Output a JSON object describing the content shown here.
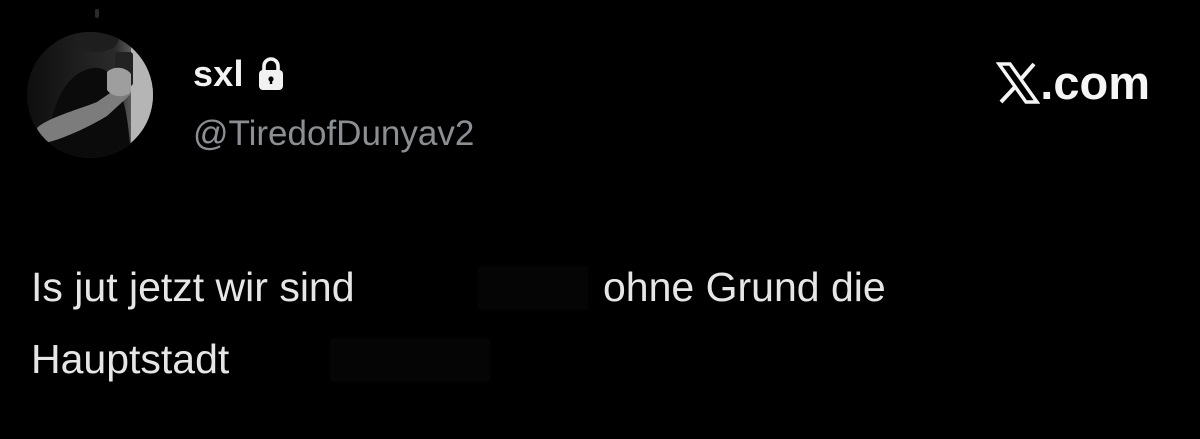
{
  "author": {
    "display_name": "sxl",
    "handle": "@TiredofDunyav2",
    "avatar_icon": "profile-photo",
    "lock_icon": "lock-icon"
  },
  "brand": {
    "logo_icon": "x-logo-icon",
    "domain_suffix": ".com"
  },
  "tweet": {
    "line1_part1": "Is jut jetzt wir sind",
    "line1_part2": "ohne Grund die",
    "line2": "Hauptstadt"
  },
  "colors": {
    "background": "#000000",
    "name": "#f2f2f2",
    "handle": "#8b8f93",
    "text": "#e6e6e6"
  }
}
